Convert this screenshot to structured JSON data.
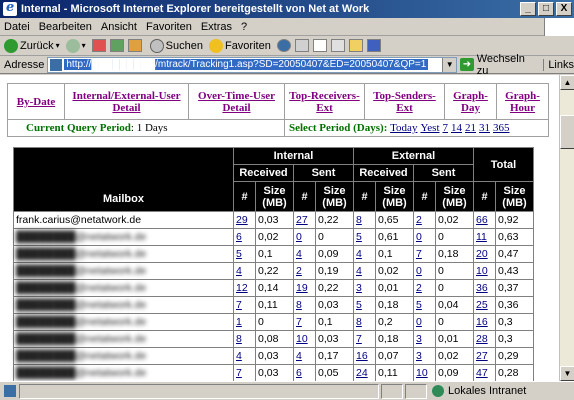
{
  "window": {
    "title": "Internal - Microsoft Internet Explorer bereitgestellt von Net at Work",
    "minimize": "_",
    "maximize": "□",
    "close": "X"
  },
  "menu": [
    "Datei",
    "Bearbeiten",
    "Ansicht",
    "Favoriten",
    "Extras",
    "?"
  ],
  "toolbar": {
    "back": "Zurück",
    "search": "Suchen",
    "favorites": "Favoriten"
  },
  "address": {
    "label": "Adresse",
    "url": "http://█████████/mtrack/Tracking1.asp?SD=20050407&ED=20050407&QP=1",
    "go": "Wechseln zu",
    "links": "Links"
  },
  "nav": {
    "by_date": "By-Date",
    "internal_external": "Internal/External-User Detail",
    "over_time": "Over-Time-User Detail",
    "top_receivers": "Top-Receivers-Ext",
    "top_senders": "Top-Senders-Ext",
    "graph_day": "Graph-Day",
    "graph_hour": "Graph-Hour",
    "current_query_label": "Current Query Period",
    "current_query_value": ": 1 Days",
    "select_period_label": "Select Period (Days):",
    "period_links": [
      "Today",
      "Yest",
      "7",
      "14",
      "21",
      "31",
      "365"
    ]
  },
  "table": {
    "headers": {
      "internal": "Internal",
      "external": "External",
      "total": "Total",
      "received": "Received",
      "sent": "Sent",
      "mailbox": "Mailbox",
      "count": "#",
      "size": "Size (MB)"
    },
    "rows": [
      {
        "mailbox": "frank.carius@netatwork.de",
        "ir": "29",
        "irs": "0,03",
        "is": "27",
        "iss": "0,22",
        "er": "8",
        "ers": "0,65",
        "es": "2",
        "ess": "0,02",
        "t": "66",
        "ts": "0,92"
      },
      {
        "mailbox": "████████@netatwork.de",
        "ir": "6",
        "irs": "0,02",
        "is": "0",
        "iss": "0",
        "er": "5",
        "ers": "0,61",
        "es": "0",
        "ess": "0",
        "t": "11",
        "ts": "0,63"
      },
      {
        "mailbox": "████████@netatwork.de",
        "ir": "5",
        "irs": "0,1",
        "is": "4",
        "iss": "0,09",
        "er": "4",
        "ers": "0,1",
        "es": "7",
        "ess": "0,18",
        "t": "20",
        "ts": "0,47"
      },
      {
        "mailbox": "████████@netatwork.de",
        "ir": "4",
        "irs": "0,22",
        "is": "2",
        "iss": "0,19",
        "er": "4",
        "ers": "0,02",
        "es": "0",
        "ess": "0",
        "t": "10",
        "ts": "0,43"
      },
      {
        "mailbox": "████████@netatwork.de",
        "ir": "12",
        "irs": "0,14",
        "is": "19",
        "iss": "0,22",
        "er": "3",
        "ers": "0,01",
        "es": "2",
        "ess": "0",
        "t": "36",
        "ts": "0,37"
      },
      {
        "mailbox": "████████@netatwork.de",
        "ir": "7",
        "irs": "0,11",
        "is": "8",
        "iss": "0,03",
        "er": "5",
        "ers": "0,18",
        "es": "5",
        "ess": "0,04",
        "t": "25",
        "ts": "0,36"
      },
      {
        "mailbox": "████████@netatwork.de",
        "ir": "1",
        "irs": "0",
        "is": "7",
        "iss": "0,1",
        "er": "8",
        "ers": "0,2",
        "es": "0",
        "ess": "0",
        "t": "16",
        "ts": "0,3"
      },
      {
        "mailbox": "████████@netatwork.de",
        "ir": "8",
        "irs": "0,08",
        "is": "10",
        "iss": "0,03",
        "er": "7",
        "ers": "0,18",
        "es": "3",
        "ess": "0,01",
        "t": "28",
        "ts": "0,3"
      },
      {
        "mailbox": "████████@netatwork.de",
        "ir": "4",
        "irs": "0,03",
        "is": "4",
        "iss": "0,17",
        "er": "16",
        "ers": "0,07",
        "es": "3",
        "ess": "0,02",
        "t": "27",
        "ts": "0,29"
      },
      {
        "mailbox": "████████@netatwork.de",
        "ir": "7",
        "irs": "0,03",
        "is": "6",
        "iss": "0,05",
        "er": "24",
        "ers": "0,11",
        "es": "10",
        "ess": "0,09",
        "t": "47",
        "ts": "0,28"
      }
    ]
  },
  "status": {
    "zone": "Lokales Intranet"
  }
}
